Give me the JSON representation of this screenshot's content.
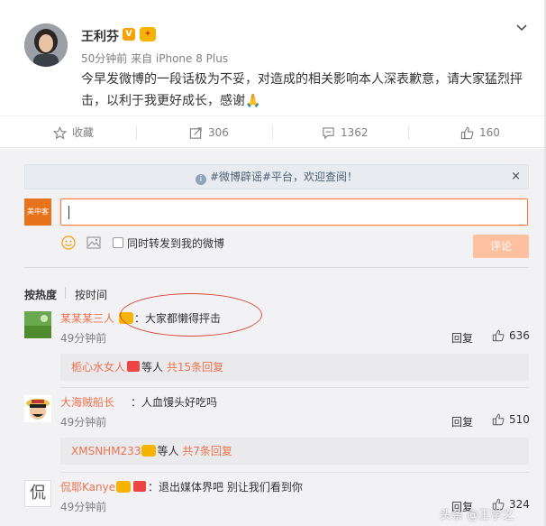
{
  "post": {
    "username": "王利芬",
    "verified_badge": "V",
    "time_source": "50分钟前 来自 iPhone 8 Plus",
    "text": "今早发微博的一段话极为不妥，对造成的相关影响本人深表歉意，请大家猛烈抨击，以利于我更好成长，感谢🙏",
    "expand_icon": "chevron-down-icon"
  },
  "actions": {
    "favorite": "收藏",
    "repost": "306",
    "comment": "1362",
    "like": "160"
  },
  "notice": {
    "text": "#微博辟谣#平台，欢迎查阅！",
    "close": "×"
  },
  "composer": {
    "avatar_text": "美中客",
    "repost_label": "同时转发到我的微博",
    "submit": "评论"
  },
  "sort": {
    "hot": "按热度",
    "time": "按时间"
  },
  "comments": [
    {
      "name": "某某某三人",
      "text": "：大家都懒得抨击",
      "time": "49分钟前",
      "reply": "回复",
      "likes": "636",
      "sub": {
        "name": "栀心水女人",
        "text": "等人",
        "count": "共15条回复"
      }
    },
    {
      "name": "大海贼船长",
      "text": "：人血馒头好吃吗",
      "time": "49分钟前",
      "reply": "回复",
      "likes": "510",
      "sub": {
        "name": "XMSNHM233",
        "text": "等人",
        "count": "共7条回复"
      }
    },
    {
      "name": "侃耶Kanye",
      "text": "：退出媒体界吧  别让我们看到你",
      "time": "49分钟前",
      "reply": "回复",
      "likes": "324"
    }
  ],
  "third_avatar_text": "侃",
  "watermark": "头条 @王学之",
  "colors": {
    "accent": "#eb7350",
    "submit": "#ffc09f",
    "panel": "#f2f2f5"
  }
}
